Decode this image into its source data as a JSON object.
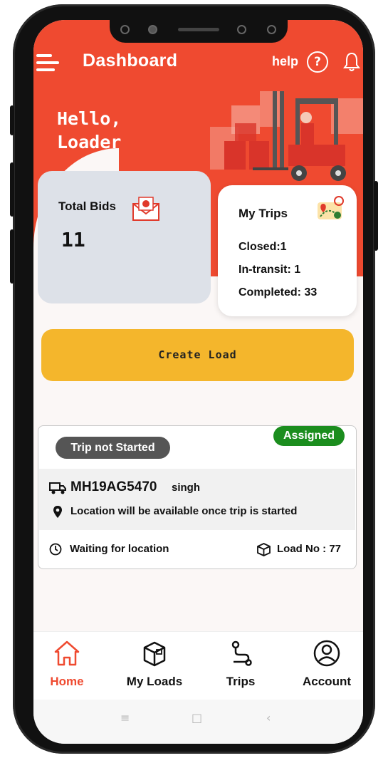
{
  "header": {
    "title": "Dashboard",
    "help_label": "help",
    "help_icon_glyph": "?",
    "greeting_line1": "Hello,",
    "greeting_line2": "Loader",
    "accent_color": "#ef4a30"
  },
  "total_bids": {
    "label": "Total Bids",
    "value": "11",
    "icon": "mail-icon"
  },
  "my_trips": {
    "title": "My Trips",
    "closed": "Closed:1",
    "in_transit": "In-transit: 1",
    "completed": "Completed: 33",
    "icon": "route-map-icon"
  },
  "create_load": {
    "label": "Create Load",
    "color": "#f4b62c"
  },
  "trip_card": {
    "status_badge": "Trip not Started",
    "assignment_badge": "Assigned",
    "vehicle_number": "MH19AG5470",
    "driver_name": "singh",
    "location_message": "Location will be available once trip is started",
    "waiting_text": "Waiting for location",
    "load_no": "Load No : 77",
    "status_color": "#555555",
    "assigned_color": "#1b8d1e"
  },
  "bottom_nav": {
    "items": [
      {
        "label": "Home",
        "icon": "home-icon",
        "active": true
      },
      {
        "label": "My Loads",
        "icon": "box-icon",
        "active": false
      },
      {
        "label": "Trips",
        "icon": "route-icon",
        "active": false
      },
      {
        "label": "Account",
        "icon": "user-icon",
        "active": false
      }
    ],
    "active_color": "#ef4a30"
  },
  "system_nav": {
    "menu_glyph": "≡",
    "home_glyph": "□",
    "back_glyph": "‹"
  }
}
